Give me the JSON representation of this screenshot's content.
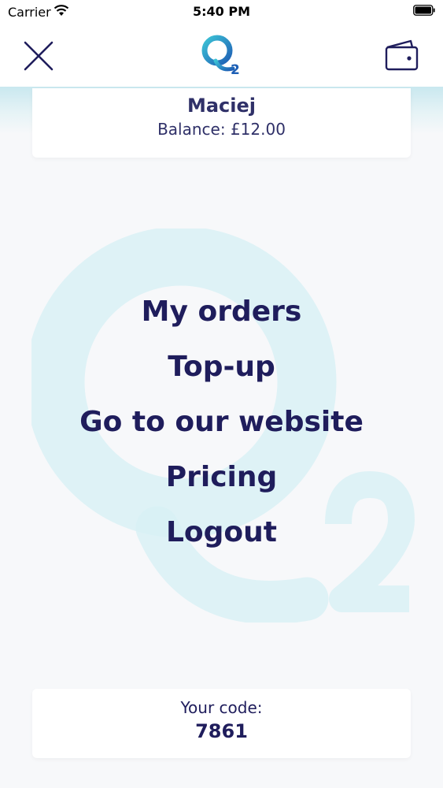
{
  "status_bar": {
    "carrier": "Carrier",
    "time": "5:40 PM"
  },
  "header": {
    "close_icon": "close-icon",
    "logo_icon": "q2-logo",
    "wallet_icon": "wallet-icon"
  },
  "user": {
    "name": "Maciej",
    "balance": "Balance: £12.00"
  },
  "menu": {
    "items": [
      {
        "label": "My orders"
      },
      {
        "label": "Top-up"
      },
      {
        "label": "Go to our website"
      },
      {
        "label": "Pricing"
      },
      {
        "label": "Logout"
      }
    ]
  },
  "code": {
    "label": "Your code:",
    "value": "7861"
  },
  "colors": {
    "primary_text": "#1f1d5c",
    "accent_teal": "#3cc3d6",
    "logo_blue": "#1e5fb5"
  }
}
